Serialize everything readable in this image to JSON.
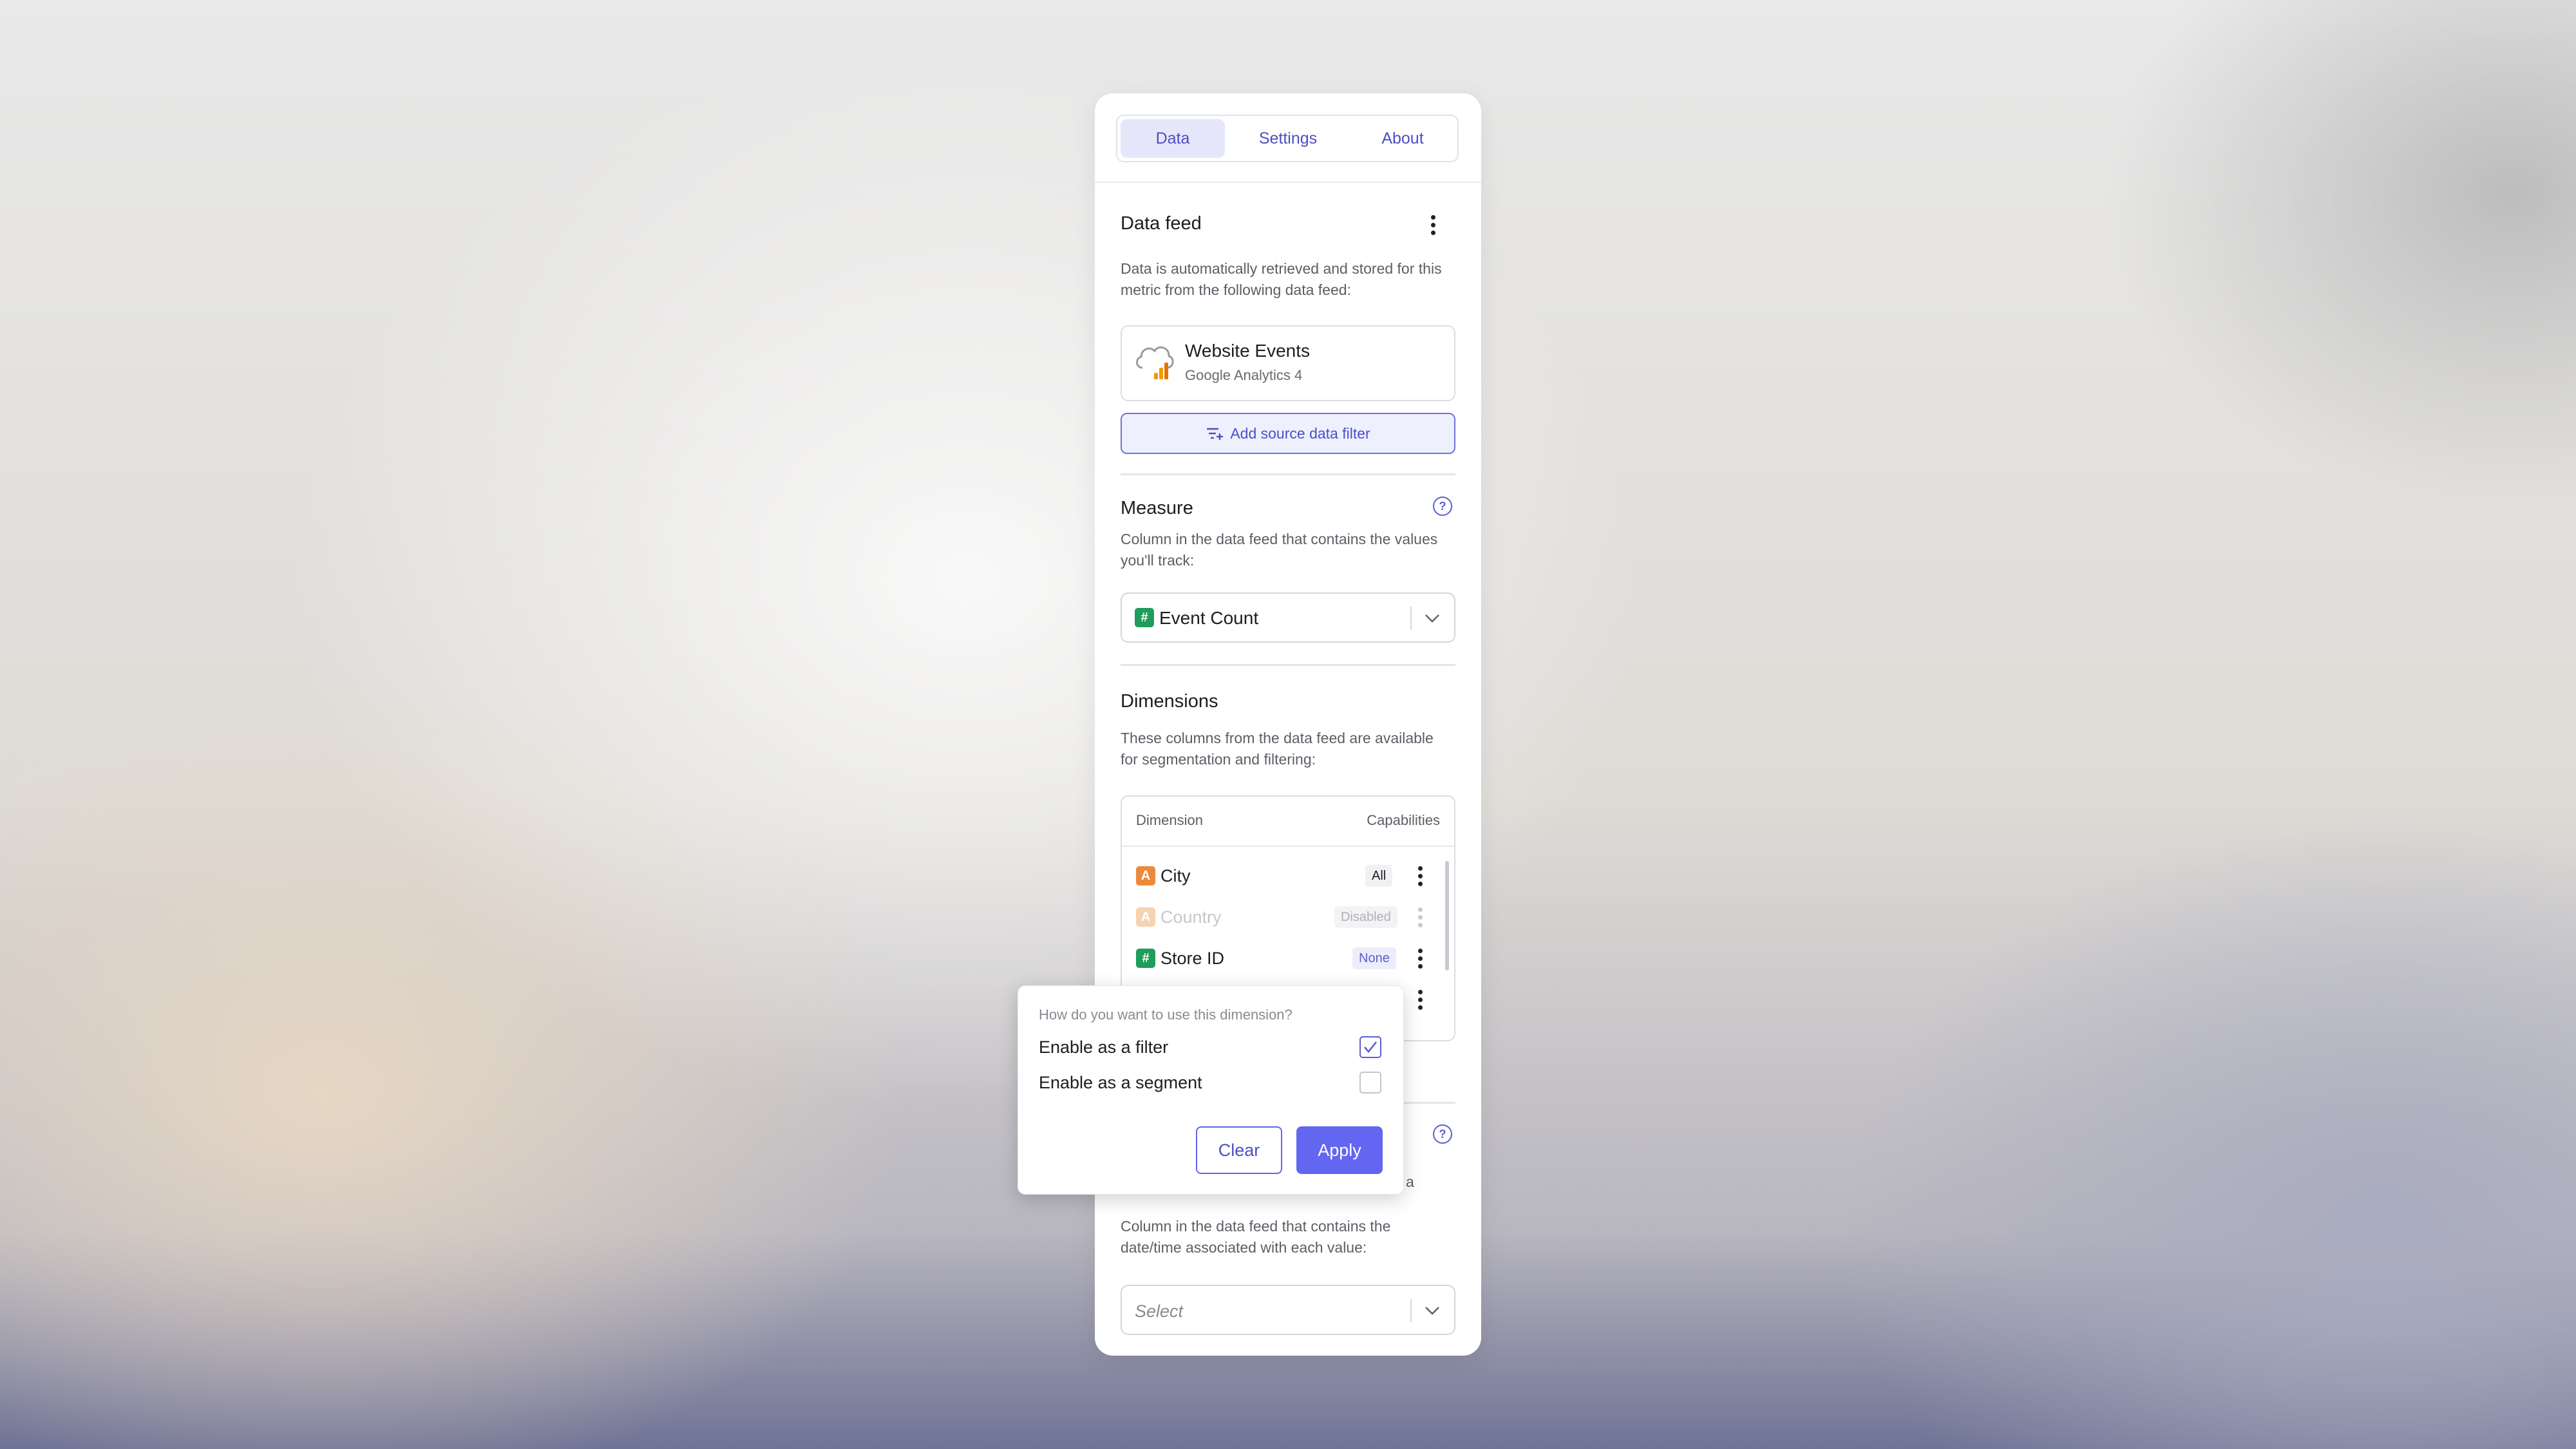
{
  "tabs": [
    {
      "label": "Data",
      "active": true
    },
    {
      "label": "Settings",
      "active": false
    },
    {
      "label": "About",
      "active": false
    }
  ],
  "data_feed": {
    "title": "Data feed",
    "description": "Data is automatically retrieved and stored for this metric from the following data feed:",
    "source_name": "Website Events",
    "source_provider": "Google Analytics 4",
    "icon": "cloud-analytics-icon",
    "add_filter_label": "Add source data filter"
  },
  "measure": {
    "title": "Measure",
    "description": "Column in the data feed that contains the values you'll track:",
    "selected_value": "Event Count",
    "type_badge": "#"
  },
  "dimensions": {
    "title": "Dimensions",
    "description": "These columns from the data feed are available for segmentation and filtering:",
    "columns": [
      "Dimension",
      "Capabilities"
    ],
    "rows": [
      {
        "badge": "A",
        "name": "City",
        "capability": "All",
        "disabled": false
      },
      {
        "badge": "A",
        "name": "Country",
        "capability": "Disabled",
        "disabled": true
      },
      {
        "badge": "#",
        "name": "Store ID",
        "capability": "None",
        "disabled": false
      }
    ]
  },
  "date": {
    "partial_text": "a",
    "description": "Column in the data feed that contains the date/time associated with each value:",
    "placeholder": "Select"
  },
  "popup": {
    "question": "How do you want to use this dimension?",
    "options": [
      {
        "label": "Enable as a filter",
        "checked": true
      },
      {
        "label": "Enable as a segment",
        "checked": false
      }
    ],
    "clear_label": "Clear",
    "apply_label": "Apply"
  },
  "colors": {
    "accent": "#6366f1",
    "numeric_badge": "#1f9d5c",
    "text_badge": "#ec8a3c"
  }
}
